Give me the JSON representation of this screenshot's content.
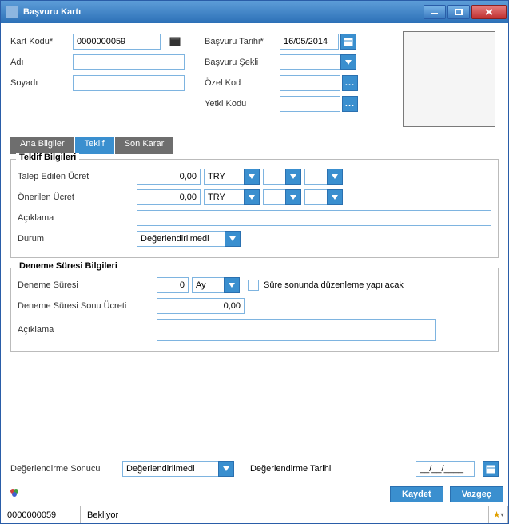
{
  "window": {
    "title": "Başvuru Kartı"
  },
  "header": {
    "kart_kodu_label": "Kart Kodu*",
    "kart_kodu_value": "0000000059",
    "adi_label": "Adı",
    "adi_value": "",
    "soyadi_label": "Soyadı",
    "soyadi_value": "",
    "basvuru_tarihi_label": "Başvuru Tarihi*",
    "basvuru_tarihi_value": "16/05/2014",
    "basvuru_sekli_label": "Başvuru Şekli",
    "basvuru_sekli_value": "",
    "ozel_kod_label": "Özel Kod",
    "ozel_kod_value": "",
    "yetki_kodu_label": "Yetki Kodu",
    "yetki_kodu_value": ""
  },
  "tabs": {
    "t1": "Ana Bilgiler",
    "t2": "Teklif",
    "t3": "Son Karar"
  },
  "teklif": {
    "section_title": "Teklif Bilgileri",
    "talep_label": "Talep Edilen Ücret",
    "talep_value": "0,00",
    "talep_currency": "TRY",
    "onerilen_label": "Önerilen Ücret",
    "onerilen_value": "0,00",
    "onerilen_currency": "TRY",
    "aciklama_label": "Açıklama",
    "aciklama_value": "",
    "durum_label": "Durum",
    "durum_value": "Değerlendirilmedi"
  },
  "deneme": {
    "section_title": "Deneme Süresi Bilgileri",
    "sure_label": "Deneme Süresi",
    "sure_value": "0",
    "sure_unit": "Ay",
    "chk_label": "Süre sonunda düzenleme yapılacak",
    "sonu_label": "Deneme Süresi Sonu Ücreti",
    "sonu_value": "0,00",
    "aciklama_label": "Açıklama",
    "aciklama_value": ""
  },
  "eval": {
    "sonuc_label": "Değerlendirme Sonucu",
    "sonuc_value": "Değerlendirilmedi",
    "tarih_label": "Değerlendirme Tarihi",
    "tarih_value": "__/__/____"
  },
  "buttons": {
    "save": "Kaydet",
    "cancel": "Vazgeç"
  },
  "status": {
    "code": "0000000059",
    "state": "Bekliyor"
  },
  "misc": {
    "ellipsis": "..."
  }
}
